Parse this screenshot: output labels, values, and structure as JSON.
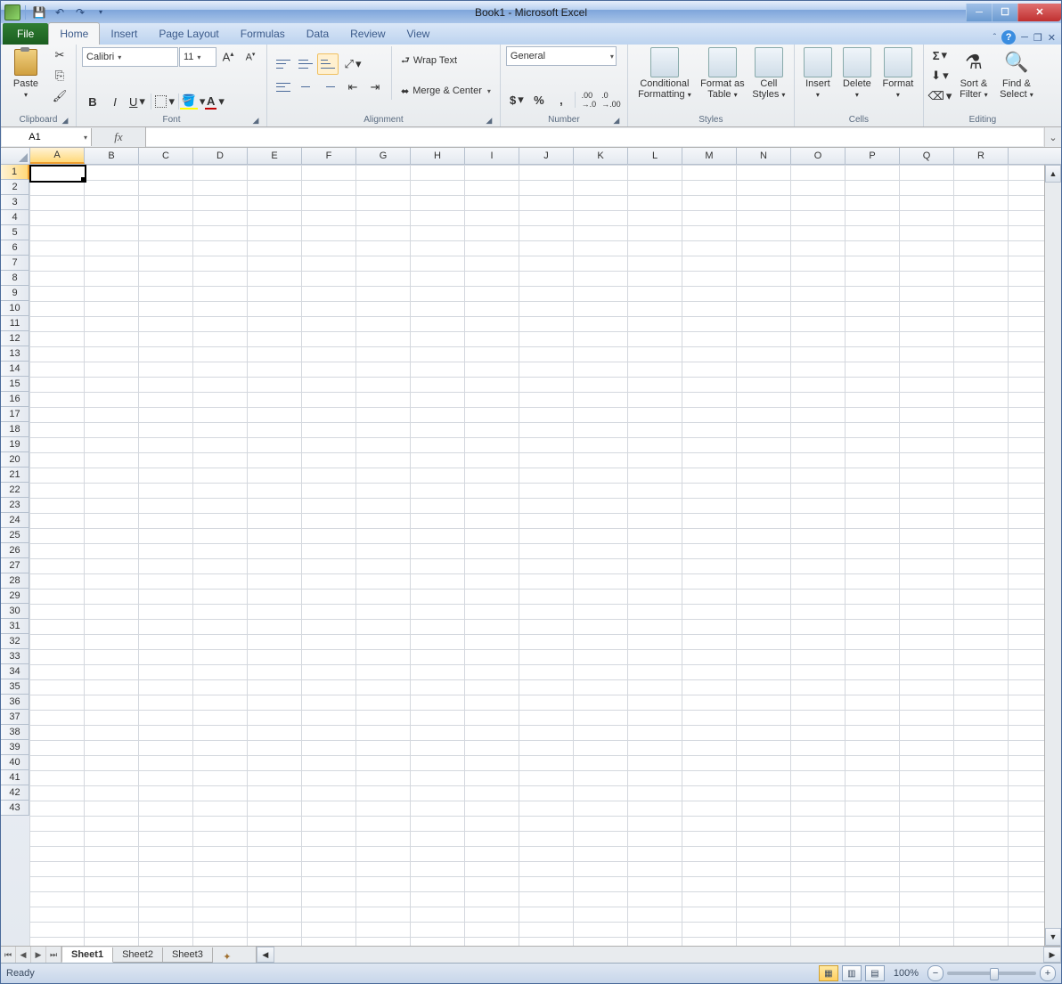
{
  "title": "Book1 - Microsoft Excel",
  "tabs": {
    "file": "File",
    "home": "Home",
    "insert": "Insert",
    "pagelayout": "Page Layout",
    "formulas": "Formulas",
    "data": "Data",
    "review": "Review",
    "view": "View"
  },
  "ribbon": {
    "clipboard": {
      "label": "Clipboard",
      "paste": "Paste"
    },
    "font": {
      "label": "Font",
      "name": "Calibri",
      "size": "11"
    },
    "alignment": {
      "label": "Alignment",
      "wrap": "Wrap Text",
      "merge": "Merge & Center"
    },
    "number": {
      "label": "Number",
      "format": "General"
    },
    "styles": {
      "label": "Styles",
      "cond": "Conditional Formatting",
      "table": "Format as Table",
      "cell": "Cell Styles"
    },
    "cells": {
      "label": "Cells",
      "insert": "Insert",
      "delete": "Delete",
      "format": "Format"
    },
    "editing": {
      "label": "Editing",
      "sort": "Sort & Filter",
      "find": "Find & Select"
    }
  },
  "namebox": "A1",
  "columns": [
    "A",
    "B",
    "C",
    "D",
    "E",
    "F",
    "G",
    "H",
    "I",
    "J",
    "K",
    "L",
    "M",
    "N",
    "O",
    "P",
    "Q",
    "R"
  ],
  "rowcount": 43,
  "sheets": {
    "s1": "Sheet1",
    "s2": "Sheet2",
    "s3": "Sheet3"
  },
  "status": {
    "ready": "Ready",
    "zoom": "100%"
  }
}
